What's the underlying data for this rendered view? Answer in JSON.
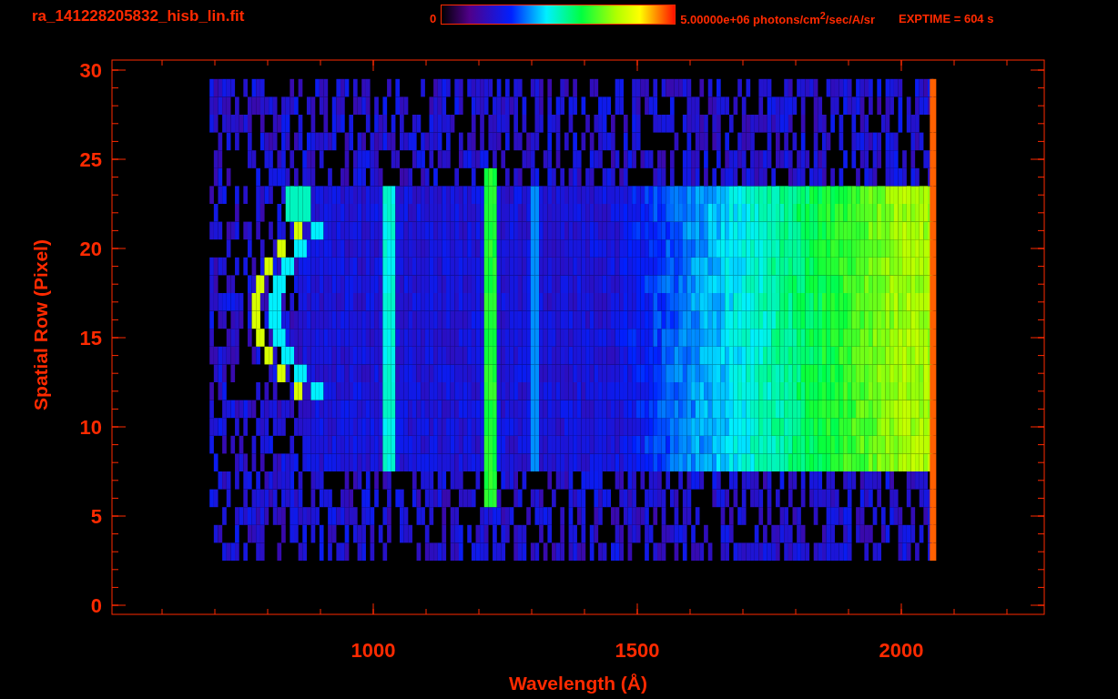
{
  "header": {
    "filename": "ra_141228205832_hisb_lin.fit",
    "colorbar": {
      "min_label": "0",
      "max_label": "5.00000e+06 photons/cm$^{2}$/sec/A/sr"
    },
    "exposure": "EXPTIME = 604 s"
  },
  "plot": {
    "xlabel": "Wavelength (Å)",
    "ylabel": "Spatial Row (Pixel)",
    "xticks": [
      "1000",
      "1500",
      "2000"
    ],
    "yticks": [
      "30",
      "25",
      "20",
      "15",
      "10",
      "5",
      "0"
    ]
  }
}
